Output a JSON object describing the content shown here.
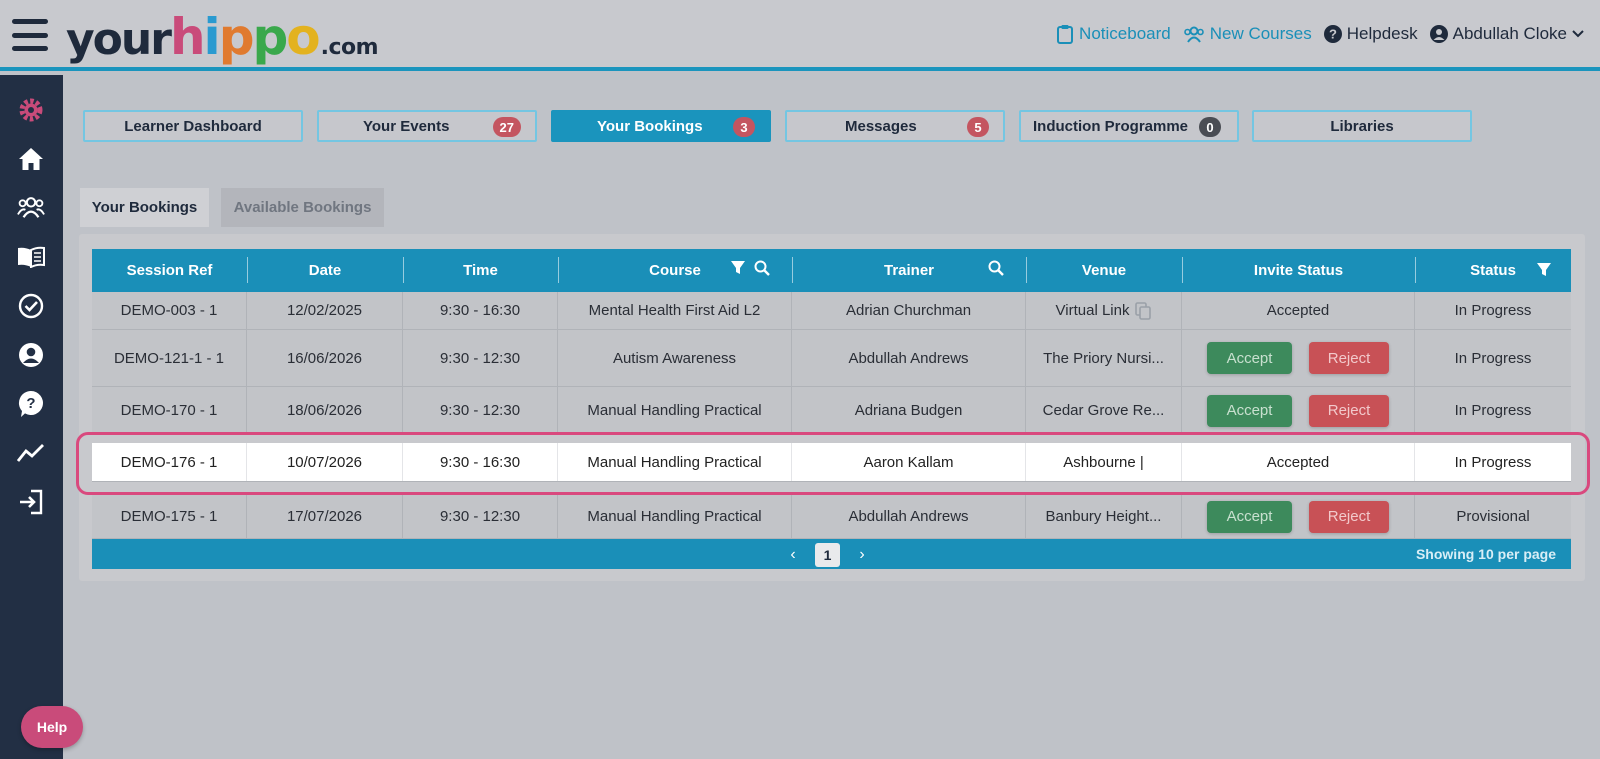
{
  "header": {
    "logo": {
      "part1": "your",
      "h": "h",
      "i": "i",
      "p1": "p",
      "p2": "p",
      "o": "o",
      "suffix": ".com"
    },
    "links": {
      "noticeboard": "Noticeboard",
      "new_courses": "New Courses",
      "helpdesk": "Helpdesk",
      "user": "Abdullah Cloke"
    },
    "icons": {
      "menu": "hamburger-icon",
      "noticeboard": "clipboard-icon",
      "new_courses": "users-icon",
      "helpdesk": "question-circle-icon",
      "user": "user-circle-icon",
      "dropdown": "chevron-down-icon"
    }
  },
  "sidebar": {
    "icons": [
      "gear-icon",
      "home-icon",
      "team-icon",
      "book-icon",
      "check-circle-icon",
      "user-circle-icon",
      "question-bubble-icon",
      "trend-chart-icon",
      "sign-in-icon"
    ],
    "help_label": "Help"
  },
  "nav_tabs": [
    {
      "label": "Learner Dashboard",
      "badge": ""
    },
    {
      "label": "Your Events",
      "badge": "27"
    },
    {
      "label": "Your Bookings",
      "badge": "3",
      "active": true
    },
    {
      "label": "Messages",
      "badge": "5"
    },
    {
      "label": "Induction Programme",
      "badge": "0"
    },
    {
      "label": "Libraries",
      "badge": ""
    }
  ],
  "sub_tabs": {
    "active": "Your Bookings",
    "inactive": "Available Bookings"
  },
  "table": {
    "columns": [
      "Session Ref",
      "Date",
      "Time",
      "Course",
      "Trainer",
      "Venue",
      "Invite Status",
      "Status"
    ],
    "rows": [
      {
        "ref": "DEMO-003 - 1",
        "date": "12/02/2025",
        "time": "9:30 - 16:30",
        "course": "Mental Health First Aid L2",
        "trainer": "Adrian Churchman",
        "venue": "Virtual Link",
        "invite": "Accepted",
        "status": "In Progress"
      },
      {
        "ref": "DEMO-121-1 - 1",
        "date": "16/06/2026",
        "time": "9:30 - 12:30",
        "course": "Autism Awareness",
        "trainer": "Abdullah Andrews",
        "venue": "The Priory Nursi...",
        "invite": "",
        "status": "In Progress"
      },
      {
        "ref": "DEMO-170 - 1",
        "date": "18/06/2026",
        "time": "9:30 - 12:30",
        "course": "Manual Handling Practical",
        "trainer": "Adriana Budgen",
        "venue": "Cedar Grove Re...",
        "invite": "",
        "status": "In Progress"
      },
      {
        "ref": "DEMO-176 - 1",
        "date": "10/07/2026",
        "time": "9:30 - 16:30",
        "course": "Manual Handling Practical",
        "trainer": "Aaron Kallam",
        "venue": "Ashbourne |",
        "invite": "Accepted",
        "status": "In Progress"
      },
      {
        "ref": "DEMO-175 - 1",
        "date": "17/07/2026",
        "time": "9:30 - 12:30",
        "course": "Manual Handling Practical",
        "trainer": "Abdullah Andrews",
        "venue": "Banbury Height...",
        "invite": "",
        "status": "Provisional"
      }
    ],
    "accept_label": "Accept",
    "reject_label": "Reject",
    "pager": {
      "prev": "‹",
      "page": "1",
      "next": "›",
      "per_page": "Showing 10 per page"
    }
  },
  "colors": {
    "accent": "#1a94bd",
    "sidebar": "#222f44",
    "badge": "#c45560",
    "accept": "#3d8a5c",
    "reject": "#c85156",
    "highlight": "#d9497e",
    "logo_h": "#c94b7a",
    "logo_i": "#2a9ad0",
    "logo_p1": "#e07a2f",
    "logo_p2": "#3aa84c",
    "logo_o": "#e3b21f"
  }
}
